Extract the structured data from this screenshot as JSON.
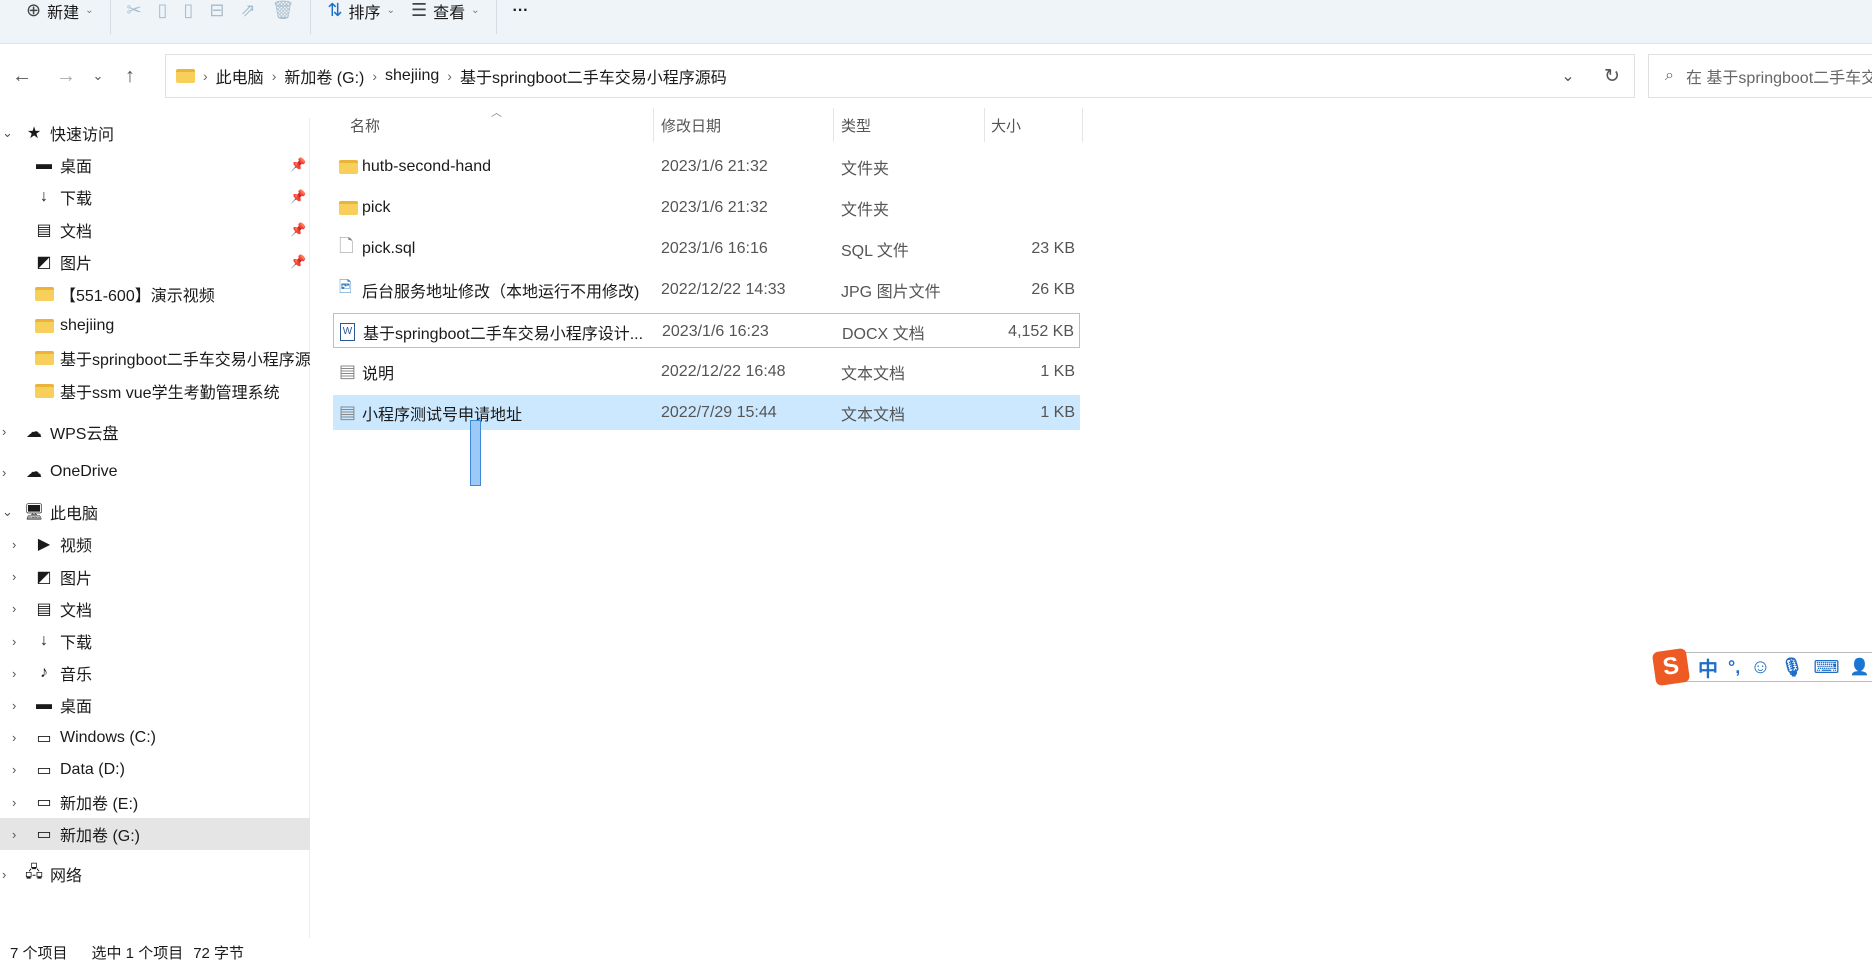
{
  "toolbar": {
    "new": "新建",
    "sort": "排序",
    "view": "查看",
    "more": "···"
  },
  "nav": {
    "crumbs": [
      "此电脑",
      "新加卷 (G:)",
      "shejiing",
      "基于springboot二手车交易小程序源码"
    ],
    "search_placeholder": "在 基于springboot二手车交易小程序源码 中搜索"
  },
  "sidebar": {
    "quick": "快速访问",
    "quick_items": [
      "桌面",
      "下载",
      "文档",
      "图片",
      "【551-600】演示视频",
      "shejiing",
      "基于springboot二手车交易小程序源码",
      "基于ssm vue学生考勤管理系统"
    ],
    "wps": "WPS云盘",
    "onedrive": "OneDrive",
    "pc": "此电脑",
    "pc_items": [
      "视频",
      "图片",
      "文档",
      "下载",
      "音乐",
      "桌面",
      "Windows (C:)",
      "Data (D:)",
      "新加卷 (E:)",
      "新加卷 (G:)"
    ],
    "network": "网络"
  },
  "columns": {
    "name": "名称",
    "date": "修改日期",
    "type": "类型",
    "size": "大小"
  },
  "files": [
    {
      "name": "hutb-second-hand",
      "date": "2023/1/6 21:32",
      "type": "文件夹",
      "size": "",
      "icon": "folder"
    },
    {
      "name": "pick",
      "date": "2023/1/6 21:32",
      "type": "文件夹",
      "size": "",
      "icon": "folder"
    },
    {
      "name": "pick.sql",
      "date": "2023/1/6 16:16",
      "type": "SQL 文件",
      "size": "23 KB",
      "icon": "file"
    },
    {
      "name": "后台服务地址修改（本地运行不用修改)",
      "date": "2022/12/22 14:33",
      "type": "JPG 图片文件",
      "size": "26 KB",
      "icon": "image"
    },
    {
      "name": "基于springboot二手车交易小程序设计...",
      "date": "2023/1/6 16:23",
      "type": "DOCX 文档",
      "size": "4,152 KB",
      "icon": "docx"
    },
    {
      "name": "说明",
      "date": "2022/12/22 16:48",
      "type": "文本文档",
      "size": "1 KB",
      "icon": "text"
    },
    {
      "name": "小程序测试号申请地址",
      "date": "2022/7/29 15:44",
      "type": "文本文档",
      "size": "1 KB",
      "icon": "text"
    }
  ],
  "status": {
    "count": "7 个项目",
    "selected": "选中 1 个项目",
    "bytes": "72 字节"
  },
  "ime": {
    "lang": "中",
    "punct": "°,"
  }
}
